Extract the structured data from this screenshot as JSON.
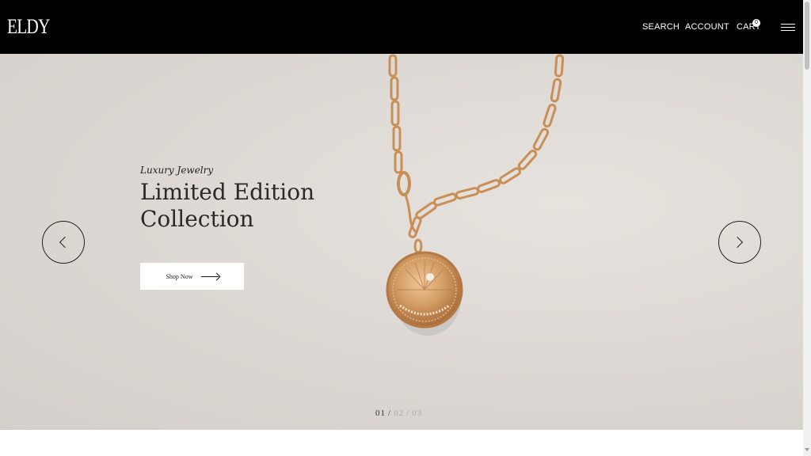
{
  "header": {
    "logo": "ELDY",
    "nav": {
      "search": "SEARCH",
      "account": "ACCOUNT",
      "cart": "CART",
      "cart_count": "0"
    }
  },
  "hero": {
    "eyebrow": "Luxury Jewelry",
    "headline_line1": "Limited Edition",
    "headline_line2": "Collection",
    "cta_label": "Shop Now",
    "pagination": {
      "current": "01",
      "second": "02",
      "third": "03",
      "separator": "/"
    }
  },
  "icons": {
    "menu": "hamburger-icon",
    "prev": "chevron-left-icon",
    "next": "chevron-right-icon",
    "cta_arrow": "arrow-right-icon"
  },
  "colors": {
    "header_bg": "#000000",
    "hero_bg": "#dcd7d2",
    "gold": "#c9955f"
  }
}
